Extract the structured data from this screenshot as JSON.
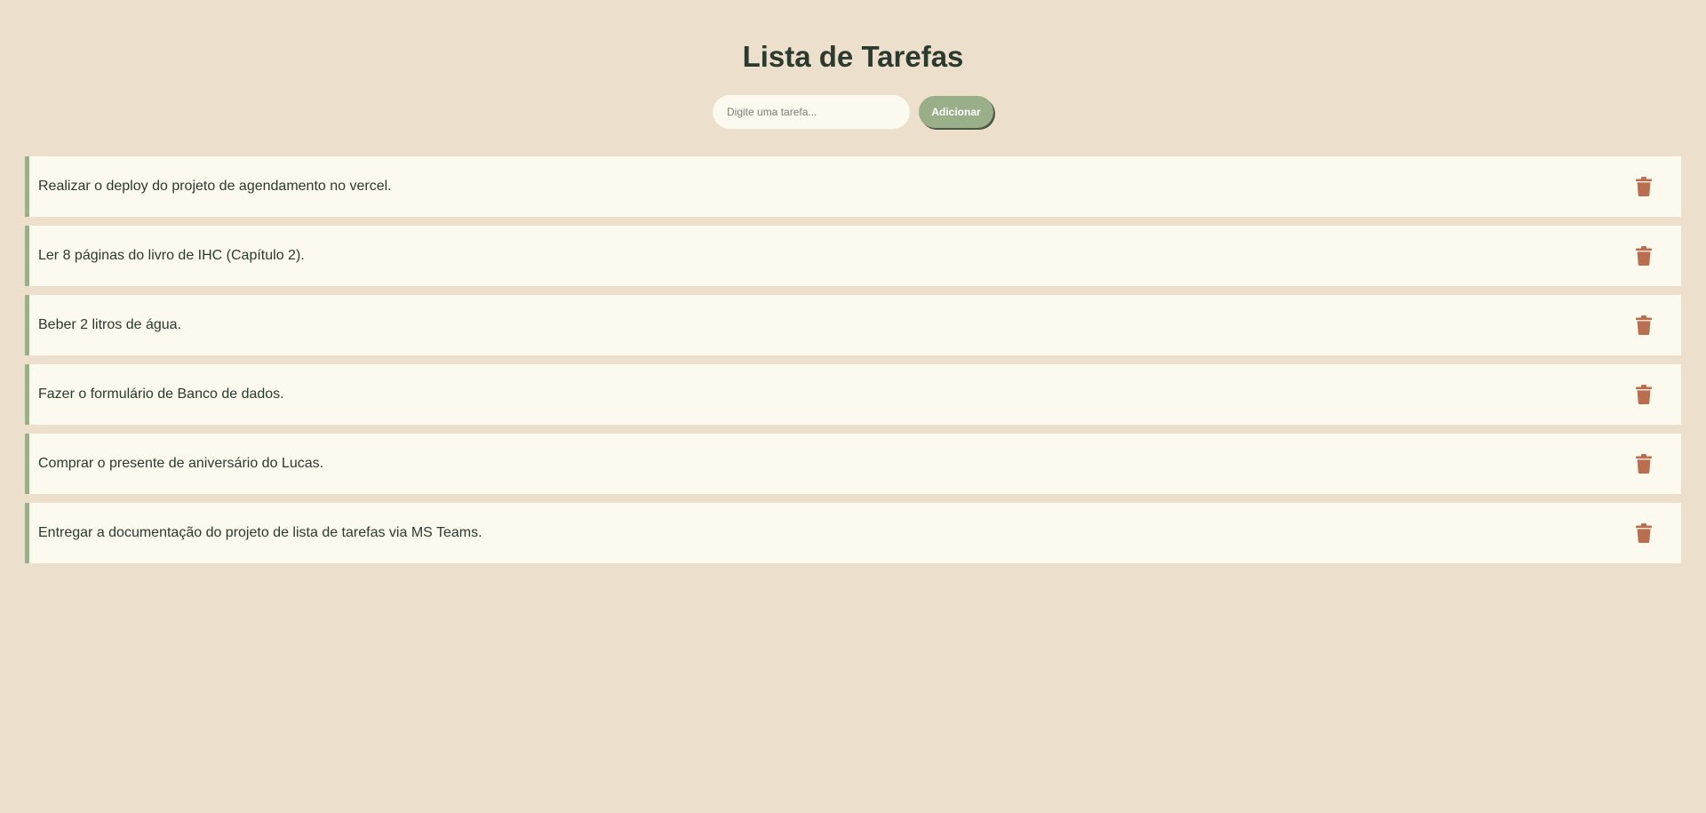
{
  "header": {
    "title": "Lista de Tarefas"
  },
  "form": {
    "input_placeholder": "Digite uma tarefa...",
    "input_value": "",
    "add_label": "Adicionar"
  },
  "tasks": [
    {
      "text": "Realizar o deploy do projeto de agendamento no vercel.",
      "delete_icon": "trash-icon"
    },
    {
      "text": "Ler 8 páginas do livro de IHC (Capítulo 2).",
      "delete_icon": "trash-icon"
    },
    {
      "text": "Beber 2 litros de água.",
      "delete_icon": "trash-icon"
    },
    {
      "text": "Fazer o formulário de Banco de dados.",
      "delete_icon": "trash-icon"
    },
    {
      "text": "Comprar o presente de aniversário do Lucas.",
      "delete_icon": "trash-icon"
    },
    {
      "text": "Entregar a documentação do projeto de lista de tarefas via MS Teams.",
      "delete_icon": "trash-icon"
    }
  ],
  "colors": {
    "background": "#ecdfcc",
    "card": "#fcf9ee",
    "accent": "#9aae8a",
    "text": "#2b3a2e",
    "delete_icon": "#b86e4f"
  }
}
